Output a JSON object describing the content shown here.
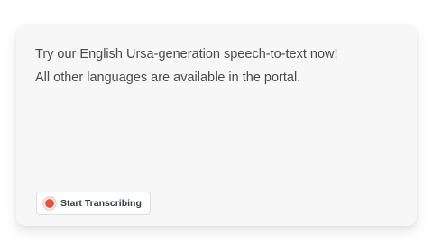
{
  "card": {
    "line1": "Try our English Ursa-generation speech-to-text now!",
    "line2": "All other languages are available in the portal.",
    "start_button": {
      "label": "Start Transcribing",
      "icon": "record-icon",
      "icon_color": "#e5533f"
    }
  }
}
